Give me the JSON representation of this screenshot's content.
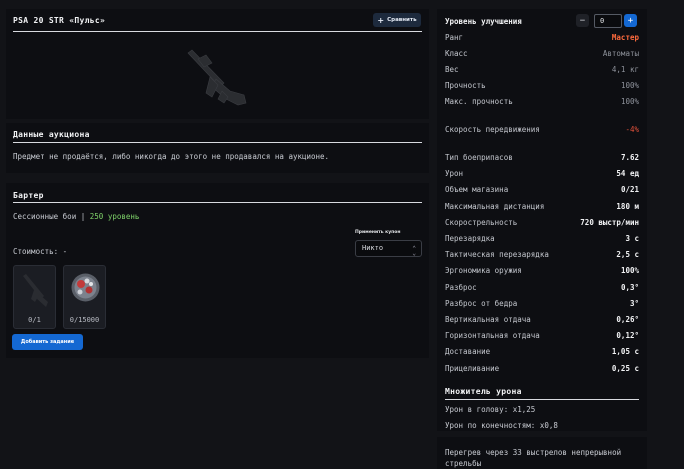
{
  "item": {
    "title": "PSA 20 STR «Пульс»",
    "compare_label": "Сравнить"
  },
  "auction": {
    "title": "Данные аукциона",
    "message": "Предмет не продаётся, либо никогда до этого не продавался на аукционе."
  },
  "barter": {
    "title": "Бартер",
    "requirement_prefix": "Сессионные бои |",
    "requirement_value": "250 уровень",
    "cost_label": "Стоимость: -",
    "apply_coupon_label": "Применить купон",
    "coupon_select_value": "Никто",
    "tiles": [
      {
        "icon": "rifle-icon",
        "count": "0/1"
      },
      {
        "icon": "material-icon",
        "count": "0/15000"
      }
    ],
    "add_task_label": "Добавить задание"
  },
  "stats": {
    "upgrade_label": "Уровень улучшения",
    "upgrade_value": "0",
    "rows_top": [
      {
        "k": "Ранг",
        "v": "Мастер",
        "style": "orange"
      },
      {
        "k": "Класс",
        "v": "Автоматы",
        "style": ""
      },
      {
        "k": "Вес",
        "v": "4,1 кг",
        "style": ""
      },
      {
        "k": "Прочность",
        "v": "100%",
        "style": ""
      },
      {
        "k": "Макс. прочность",
        "v": "100%",
        "style": ""
      },
      {
        "k": "Скорость передвижения",
        "v": "-4%",
        "style": "red"
      }
    ],
    "rows_main": [
      {
        "k": "Тип боеприпасов",
        "v": "7.62"
      },
      {
        "k": "Урон",
        "v": "54 ед"
      },
      {
        "k": "Объем магазина",
        "v": "0/21"
      },
      {
        "k": "Максимальная дистанция",
        "v": "180 м"
      },
      {
        "k": "Скорострельность",
        "v": "720 выстр/мин"
      },
      {
        "k": "Перезарядка",
        "v": "3 с"
      },
      {
        "k": "Тактическая перезарядка",
        "v": "2,5 с"
      },
      {
        "k": "Эргономика оружия",
        "v": "100%"
      },
      {
        "k": "Разброс",
        "v": "0,3°"
      },
      {
        "k": "Разброс от бедра",
        "v": "3°"
      },
      {
        "k": "Вертикальная отдача",
        "v": "0,26°"
      },
      {
        "k": "Горизонтальная отдача",
        "v": "0,12°"
      },
      {
        "k": "Доставание",
        "v": "1,05 с"
      },
      {
        "k": "Прицеливание",
        "v": "0,25 с"
      }
    ],
    "damage_title": "Множитель урона",
    "damage_rows": [
      "Урон в голову: x1,25",
      "Урон по конечностям: x0,8"
    ],
    "overheat_note": "Перегрев через 33 выстрелов непрерывной стрельбы"
  },
  "colors": {
    "accent": "#1468d2",
    "requirement": "#7fd36a",
    "rank": "#ff6a3d",
    "negative": "#e0503a"
  }
}
